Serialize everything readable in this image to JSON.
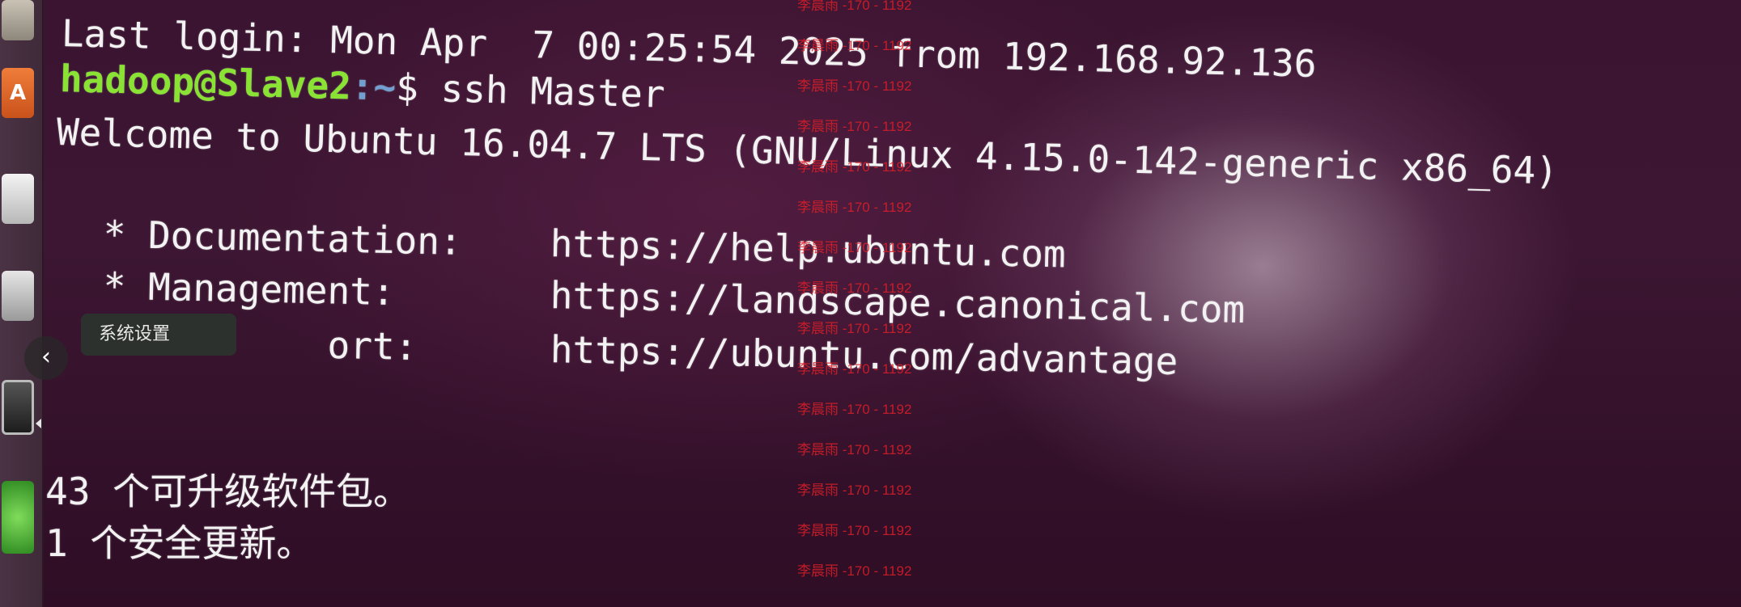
{
  "terminal": {
    "last_login": "Last login: Mon Apr  7 00:25:54 2025 from 192.168.92.136",
    "prompt_user_host": "hadoop@Slave2",
    "prompt_path": ":~",
    "prompt_symbol": "$",
    "command": "ssh Master",
    "welcome": "Welcome to Ubuntu 16.04.7 LTS (GNU/Linux 4.15.0-142-generic x86_64)",
    "docs_label": " * Documentation:",
    "docs_url": "https://help.ubuntu.com",
    "mgmt_label": " * Management:",
    "mgmt_url": "https://landscape.canonical.com",
    "support_label": "           ort:",
    "support_url": "https://ubuntu.com/advantage",
    "upgrades": "43 个可升级软件包。",
    "security": "1 个安全更新。"
  },
  "tooltip": {
    "text": "系统设置"
  },
  "viewer": {
    "prev_glyph": "‹"
  },
  "watermark": {
    "text": "李晨雨 -170 - 1192",
    "lines": [
      "李晨雨 -170 - 1192",
      "李晨雨 -170 - 1192",
      "李晨雨 -170 - 1192",
      "李晨雨 -170 - 1192",
      "李晨雨 -170 - 1192",
      "李晨雨 -170 - 1192",
      "李晨雨 -170 - 1192",
      "李晨雨 -170 - 1192",
      "李晨雨 -170 - 1192",
      "李晨雨 -170 - 1192",
      "李晨雨 -170 - 1192",
      "李晨雨 -170 - 1192",
      "李晨雨 -170 - 1192",
      "李晨雨 -170 - 1192",
      "李晨雨 -170 - 1192"
    ]
  },
  "colors": {
    "terminal_bg": "#3a1430",
    "prompt_user": "#8ae234",
    "prompt_path": "#729fcf",
    "text": "#f2f2f2",
    "watermark": "#dc1e28"
  }
}
